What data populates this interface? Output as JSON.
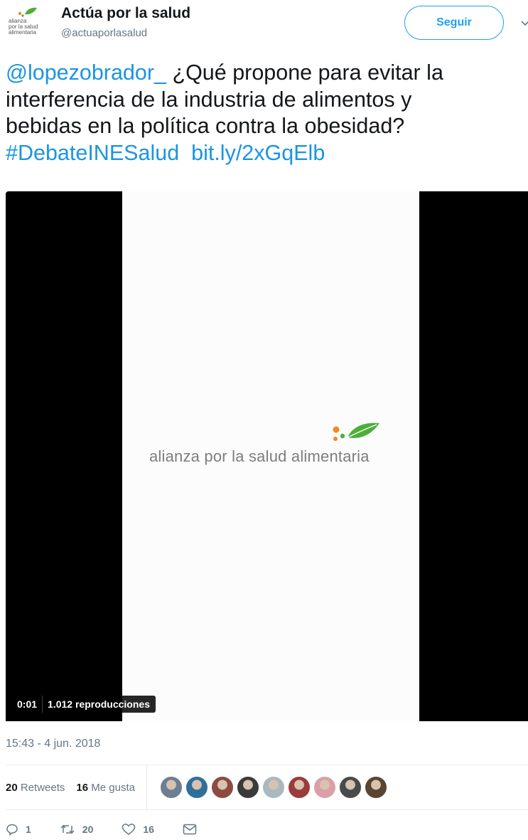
{
  "account": {
    "avatar_text": [
      "alianza",
      "por la salud",
      "alimentaria"
    ],
    "name": "Actúa por la salud",
    "handle": "@actuaporlasalud",
    "follow_label": "Seguir"
  },
  "tweet": {
    "mention": "@lopezobrador_",
    "line1_rest": " ¿Qué propone para evitar la",
    "line2": "interferencia de la industria de alimentos y",
    "line3": "bebidas en la política contra la obesidad?",
    "hashtag": "#DebateINESalud",
    "url": "bit.ly/2xGqElb"
  },
  "video": {
    "brand_text": "alianza por la salud alimentaria",
    "time": "0:01",
    "views": "1.012 reproducciones"
  },
  "timestamp": "15:43 - 4 jun. 2018",
  "stats": {
    "retweets_count": "20",
    "retweets_label": "Retweets",
    "likes_count": "16",
    "likes_label": "Me gusta"
  },
  "actions": {
    "reply_count": "1",
    "retweet_count": "20",
    "like_count": "16"
  },
  "icons": [
    "chevron-down-icon",
    "reply-icon",
    "retweet-icon",
    "heart-icon",
    "message-icon"
  ],
  "colors": {
    "accent": "#1da1f2",
    "link": "#1b95e0",
    "muted": "#657786",
    "brand_leaf": "#4caf3a",
    "brand_dot_orange": "#f08a24"
  },
  "liker_avatar_colors": [
    "#6b7f94",
    "#2f6f9a",
    "#8c4b3f",
    "#3a3a3a",
    "#aab8c2",
    "#9b3b3b",
    "#d9a0a8",
    "#4a4a4a",
    "#5a4630"
  ]
}
